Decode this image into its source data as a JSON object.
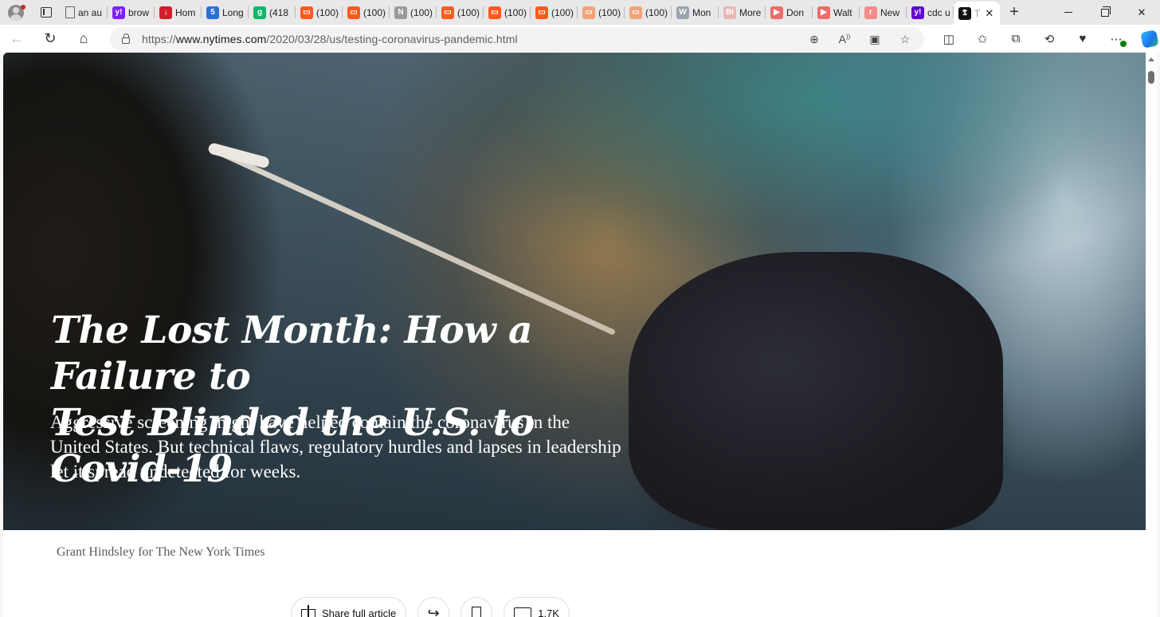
{
  "browser": {
    "tabs": [
      {
        "title": "an au",
        "favicon": "document-icon",
        "color": "#6b6b6b"
      },
      {
        "title": "brow",
        "favicon": "yahoo-icon",
        "color": "#7e1fff",
        "glyph": "y!"
      },
      {
        "title": "Hom",
        "favicon": "red-shield-icon",
        "color": "#d01f2a",
        "glyph": "↓"
      },
      {
        "title": "Long",
        "favicon": "blue-5-icon",
        "color": "#2c6fdb",
        "glyph": "5"
      },
      {
        "title": "(418",
        "favicon": "green-g-icon",
        "color": "#12b76a",
        "glyph": "g"
      },
      {
        "title": "(100)",
        "favicon": "orange-bookmark-icon",
        "color": "#ff5a1f",
        "glyph": "▭"
      },
      {
        "title": "(100)",
        "favicon": "orange-bookmark-icon",
        "color": "#ff5a1f",
        "glyph": "▭"
      },
      {
        "title": "(100)",
        "favicon": "newspaper-icon",
        "color": "#9a9a9a",
        "glyph": "N"
      },
      {
        "title": "(100)",
        "favicon": "orange-bookmark-icon",
        "color": "#ff5a1f",
        "glyph": "▭"
      },
      {
        "title": "(100)",
        "favicon": "orange-bookmark-icon",
        "color": "#ff5a1f",
        "glyph": "▭"
      },
      {
        "title": "(100)",
        "favicon": "orange-bookmark-icon",
        "color": "#ff5a1f",
        "glyph": "▭"
      },
      {
        "title": "(100)",
        "favicon": "light-orange-bookmark-icon",
        "color": "#f0a47a",
        "glyph": "▭"
      },
      {
        "title": "(100)",
        "favicon": "light-orange-bookmark-icon",
        "color": "#f0a47a",
        "glyph": "▭"
      },
      {
        "title": "Mon",
        "favicon": "wordpress-icon",
        "color": "#9aa4b0",
        "glyph": "W"
      },
      {
        "title": "More",
        "favicon": "bi-icon",
        "color": "#e9b6b6",
        "glyph": "BI"
      },
      {
        "title": "Don",
        "favicon": "youtube-icon",
        "color": "#f06b6b",
        "glyph": "▶"
      },
      {
        "title": "Walt",
        "favicon": "youtube-icon",
        "color": "#f06b6b",
        "glyph": "▶"
      },
      {
        "title": "New",
        "favicon": "pink-r-icon",
        "color": "#f28b8b",
        "glyph": "r"
      },
      {
        "title": "cdc u",
        "favicon": "yahoo-icon",
        "color": "#6001d2",
        "glyph": "y!"
      }
    ],
    "active_tab": {
      "title": "T",
      "favicon": "nyt-icon"
    },
    "url_prefix": "https://",
    "url_host": "www.nytimes.com",
    "url_path": "/2020/03/28/us/testing-coronavirus-pandemic.html"
  },
  "article": {
    "headline_line1": "The Lost Month: How a Failure to",
    "headline_line2": "Test Blinded the U.S. to Covid-19",
    "summary": "Aggressive screening might have helped contain the coronavirus in the United States. But technical flaws, regulatory hurdles and lapses in leadership let it spread undetected for weeks.",
    "photo_credit": "Grant Hindsley for The New York Times",
    "share_label": "Share full article",
    "comment_count": "1.7K"
  }
}
